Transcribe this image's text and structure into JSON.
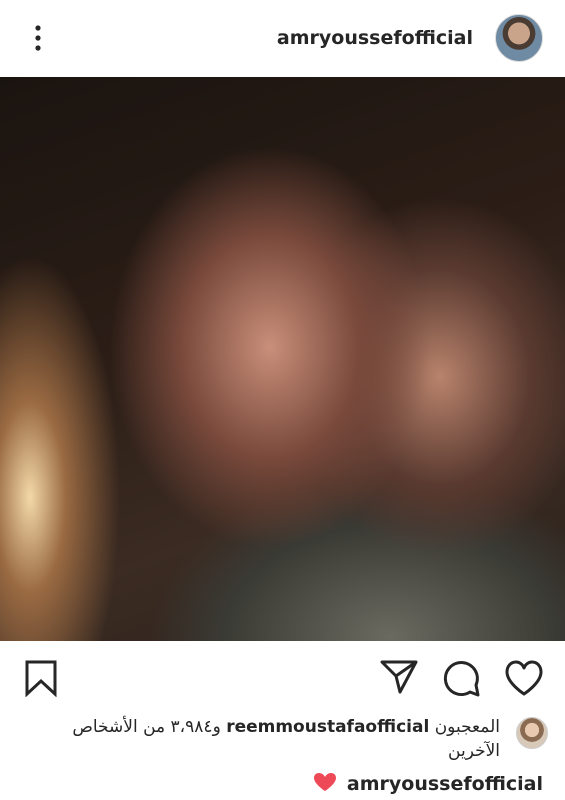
{
  "header": {
    "username": "amryoussefofficial"
  },
  "likes": {
    "prefix": "المعجبون",
    "liker": "reemmoustafaofficial",
    "suffix": "و٣،٩٨٤ من الأشخاص الآخرين"
  },
  "caption": {
    "username": "amryoussefofficial"
  },
  "colors": {
    "heart": "#ed4956",
    "text": "#262626"
  },
  "icons": {
    "more": "more-options-icon",
    "tag": "user-tag-icon",
    "save": "bookmark-icon",
    "share": "send-icon",
    "comment": "comment-icon",
    "like": "heart-icon"
  }
}
